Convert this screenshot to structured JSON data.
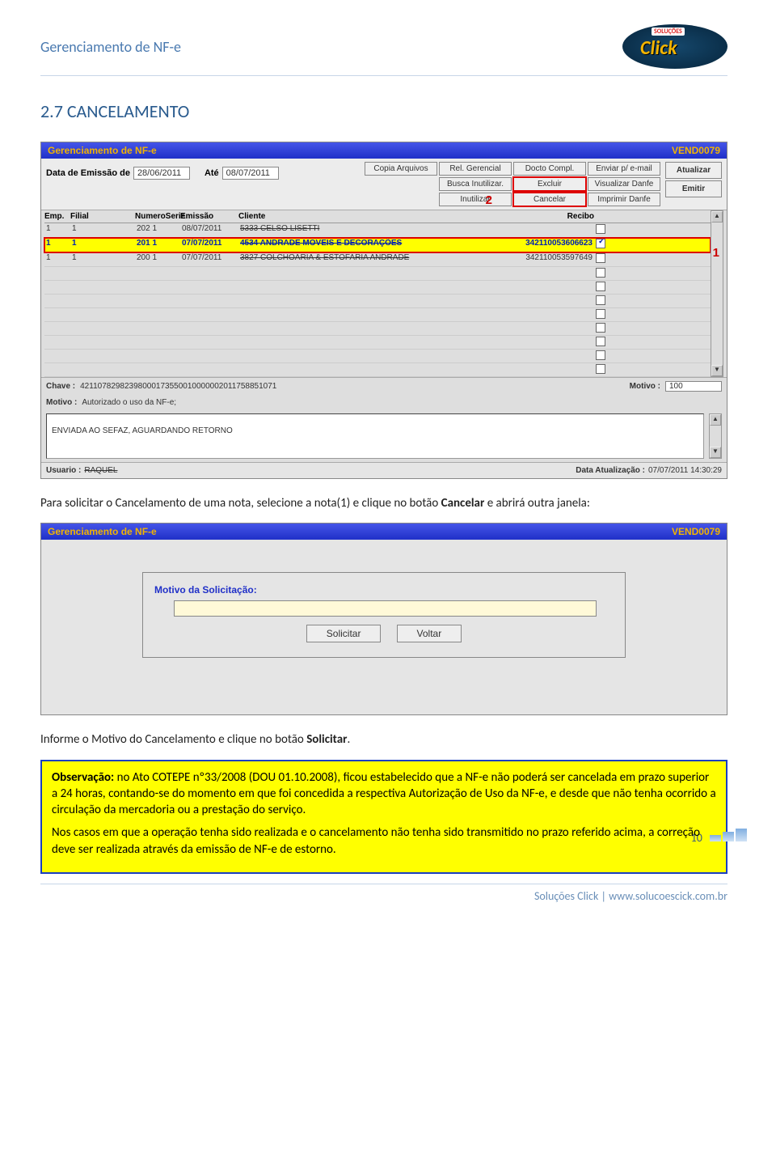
{
  "doc_header": "Gerenciamento de NF-e",
  "logo": {
    "main": "Click",
    "sub": "SOLUÇÕES"
  },
  "section_heading": "2.7 CANCELAMENTO",
  "screenshot1": {
    "title_left": "Gerenciamento de NF-e",
    "title_right": "VEND0079",
    "date_label1": "Data de Emissão de",
    "date1": "28/06/2011",
    "date_label2": "Até",
    "date2": "08/07/2011",
    "buttons": {
      "r1c1": "Copia Arquivos",
      "r1c2": "Rel. Gerencial",
      "r1c3": "Docto Compl.",
      "r1c4": "Enviar p/ e-mail",
      "r2c1": "Busca Inutilizar.",
      "r2c2": "Excluir",
      "r2c3": "Visualizar Danfe",
      "r3c1": "Inutilizar",
      "r3c2": "Cancelar",
      "r3c3": "Imprimir Danfe"
    },
    "side_buttons": {
      "b1": "Atualizar",
      "b2": "Emitir"
    },
    "grid_headers": {
      "c1": "Emp.",
      "c2": "Filial",
      "c3": "NumeroSerie",
      "c4": "Emissão",
      "c5": "Cliente",
      "c6": "Recibo"
    },
    "rows": [
      {
        "emp": "1",
        "filial": "1",
        "num": "202 1",
        "emissao": "08/07/2011",
        "cliente": "5333 CELSO LISETTI",
        "recibo": "",
        "checked": false
      },
      {
        "emp": "1",
        "filial": "1",
        "num": "201 1",
        "emissao": "07/07/2011",
        "cliente": "4534 ANDRADE MOVEIS E DECORAÇÕES",
        "recibo": "342110053606623",
        "checked": true,
        "selected": true
      },
      {
        "emp": "1",
        "filial": "1",
        "num": "200 1",
        "emissao": "07/07/2011",
        "cliente": "3827 COLCHOARIA & ESTOFARIA ANDRADE",
        "recibo": "342110053597649",
        "checked": false
      }
    ],
    "annotations": {
      "a1": "1",
      "a2": "2"
    },
    "chave_label": "Chave :",
    "chave_value": "42110782982398000173550010000002011758851071",
    "motivo_num_label": "Motivo :",
    "motivo_num_value": "100",
    "motivo2_label": "Motivo :",
    "motivo2_value": "Autorizado o uso da NF-e;",
    "textarea_value": "ENVIADA AO SEFAZ, AGUARDANDO RETORNO",
    "usuario_label": "Usuario :",
    "usuario_value": "RAQUEL",
    "data_atual_label": "Data Atualização :",
    "data_atual_value": "07/07/2011 14:30:29"
  },
  "body_text_1a": "Para solicitar o Cancelamento de uma nota, selecione a nota(1) e clique no botão ",
  "body_text_1b": "Cancelar",
  "body_text_1c": " e abrirá outra janela:",
  "screenshot2": {
    "title_left": "Gerenciamento de NF-e",
    "title_right": "VEND0079",
    "motivo_label": "Motivo da Solicitação:",
    "btn_solicitar": "Solicitar",
    "btn_voltar": "Voltar"
  },
  "body_text_2a": "Informe o Motivo do Cancelamento e clique no botão ",
  "body_text_2b": "Solicitar",
  "body_text_2c": ".",
  "obs": {
    "p1a": "Observação:",
    "p1b": " no Ato COTEPE nº33/2008 (DOU 01.10.2008), ficou estabelecido que a NF-e não poderá ser cancelada em prazo superior a 24 horas, contando-se do momento em que foi concedida a respectiva Autorização de Uso da NF-e, e desde que não tenha ocorrido a circulação da mercadoria ou a prestação do serviço.",
    "p2": "Nos casos em que a operação tenha sido realizada e o cancelamento não tenha sido transmitido no prazo referido acima, a correção deve ser realizada através da emissão de NF-e de estorno."
  },
  "page_number": "10",
  "footer_text": "Soluções Click | www.solucoescick.com.br"
}
